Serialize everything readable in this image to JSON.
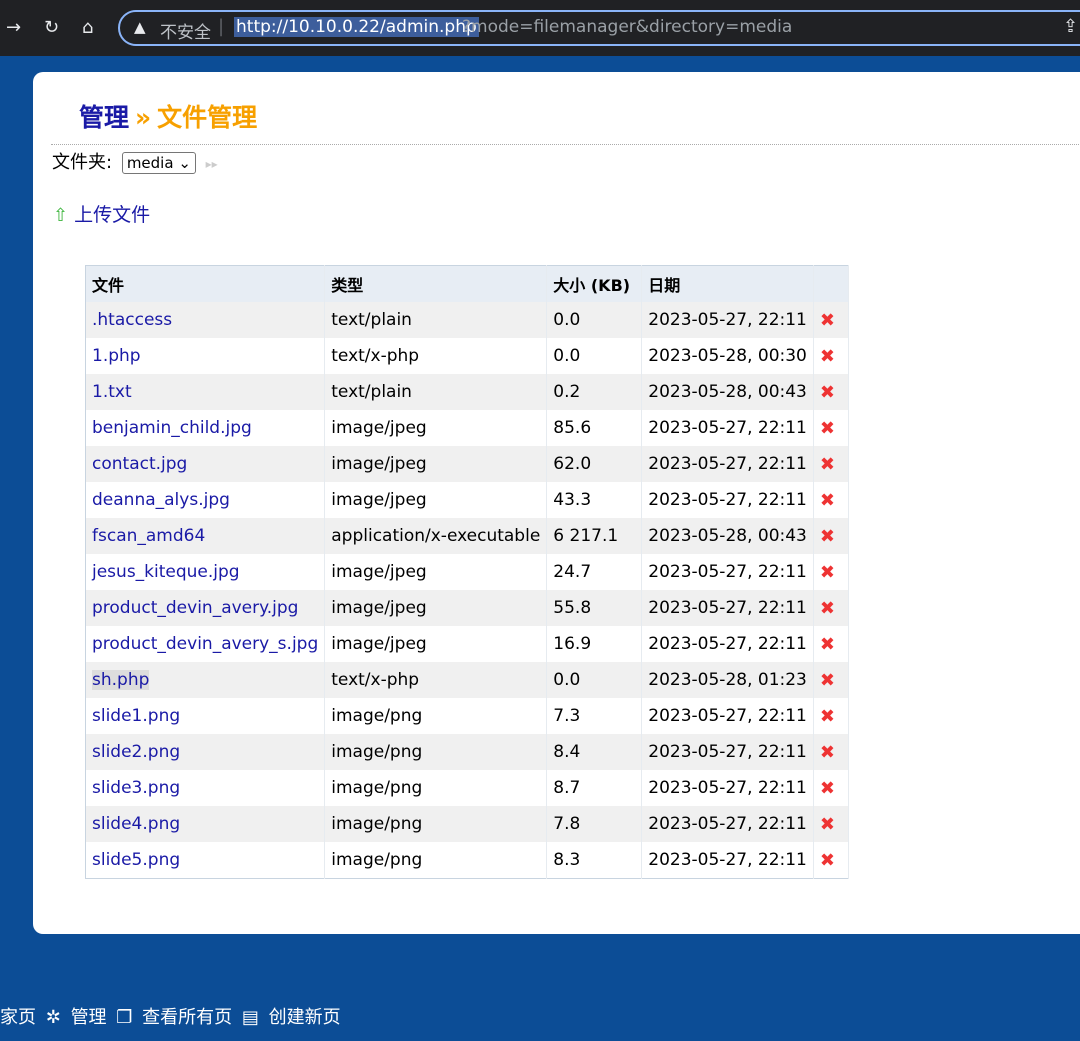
{
  "browser": {
    "security_label": "不安全",
    "url_host": "http://10.10.0.22/admin.php",
    "url_query": "?mode=filemanager&directory=media"
  },
  "page": {
    "title_admin": "管理",
    "title_sep": "»",
    "title_section": "文件管理",
    "folder_label": "文件夹:",
    "folder_value": "media",
    "upload_label": "上传文件"
  },
  "table": {
    "headers": [
      "文件",
      "类型",
      "大小 (KB)",
      "日期"
    ],
    "rows": [
      {
        "name": ".htaccess",
        "type": "text/plain",
        "size": "0.0",
        "date": "2023-05-27, 22:11"
      },
      {
        "name": "1.php",
        "type": "text/x-php",
        "size": "0.0",
        "date": "2023-05-28, 00:30"
      },
      {
        "name": "1.txt",
        "type": "text/plain",
        "size": "0.2",
        "date": "2023-05-28, 00:43"
      },
      {
        "name": "benjamin_child.jpg",
        "type": "image/jpeg",
        "size": "85.6",
        "date": "2023-05-27, 22:11"
      },
      {
        "name": "contact.jpg",
        "type": "image/jpeg",
        "size": "62.0",
        "date": "2023-05-27, 22:11"
      },
      {
        "name": "deanna_alys.jpg",
        "type": "image/jpeg",
        "size": "43.3",
        "date": "2023-05-27, 22:11"
      },
      {
        "name": "fscan_amd64",
        "type": "application/x-executable",
        "size": "6 217.1",
        "date": "2023-05-28, 00:43"
      },
      {
        "name": "jesus_kiteque.jpg",
        "type": "image/jpeg",
        "size": "24.7",
        "date": "2023-05-27, 22:11"
      },
      {
        "name": "product_devin_avery.jpg",
        "type": "image/jpeg",
        "size": "55.8",
        "date": "2023-05-27, 22:11"
      },
      {
        "name": "product_devin_avery_s.jpg",
        "type": "image/jpeg",
        "size": "16.9",
        "date": "2023-05-27, 22:11"
      },
      {
        "name": "sh.php",
        "type": "text/x-php",
        "size": "0.0",
        "date": "2023-05-28, 01:23"
      },
      {
        "name": "slide1.png",
        "type": "image/png",
        "size": "7.3",
        "date": "2023-05-27, 22:11"
      },
      {
        "name": "slide2.png",
        "type": "image/png",
        "size": "8.4",
        "date": "2023-05-27, 22:11"
      },
      {
        "name": "slide3.png",
        "type": "image/png",
        "size": "8.7",
        "date": "2023-05-27, 22:11"
      },
      {
        "name": "slide4.png",
        "type": "image/png",
        "size": "7.8",
        "date": "2023-05-27, 22:11"
      },
      {
        "name": "slide5.png",
        "type": "image/png",
        "size": "8.3",
        "date": "2023-05-27, 22:11"
      }
    ],
    "delete_icon": "delete-x-icon"
  },
  "footer": {
    "home": "家页",
    "admin": "管理",
    "view_pages": "查看所有页",
    "new_page": "创建新页"
  },
  "colors": {
    "page_bg": "#0c4d96",
    "link": "#1a1aa6",
    "accent": "#f7a000",
    "delete": "#ee3333"
  }
}
